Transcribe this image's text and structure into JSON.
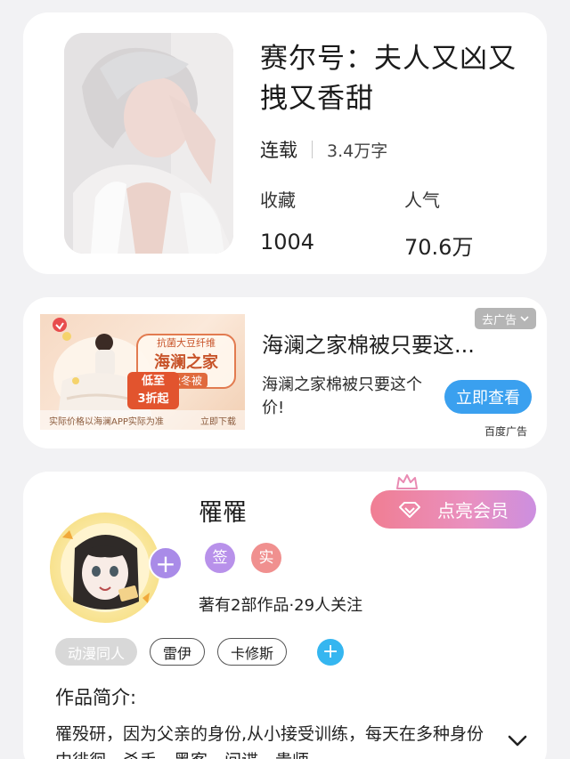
{
  "book": {
    "title": "赛尔号：夫人又凶又拽又香甜",
    "status": "连载",
    "word_count": "3.4万字",
    "favorites_label": "收藏",
    "favorites_value": "1004",
    "popularity_label": "人气",
    "popularity_value": "70.6万"
  },
  "ad": {
    "skip_label": "去广告",
    "title": "海澜之家棉被只要这...",
    "description": "海澜之家棉被只要这个价!",
    "cta_label": "立即查看",
    "source": "百度广告",
    "image_badge_top": "抗菌大豆纤维",
    "image_badge_main": "海澜之家",
    "image_badge_sub": "秋冬被",
    "image_price_top": "低至",
    "image_price_main": "3折起",
    "image_footer_left": "实际价格以海澜APP实际为准",
    "image_footer_right": "立即下载"
  },
  "author": {
    "name": "罹罹",
    "badge_sign": "签",
    "badge_real": "实",
    "meta": "著有2部作品·29人关注",
    "vip_label": "点亮会员",
    "tags": [
      "动漫同人",
      "雷伊",
      "卡修斯"
    ],
    "intro_heading": "作品简介:",
    "intro_text": "罹殁研，因为父亲的身份,从小接受训练，每天在多种身份中徘徊，杀手、黑客、间谍、贵师"
  },
  "colors": {
    "accent_blue": "#3aa0ef",
    "vip_gradient_start": "#f07e93",
    "vip_gradient_end": "#cc8fe0",
    "sign_badge": "#b891ea",
    "real_badge": "#f0908f",
    "tag_add": "#35b6f0"
  }
}
